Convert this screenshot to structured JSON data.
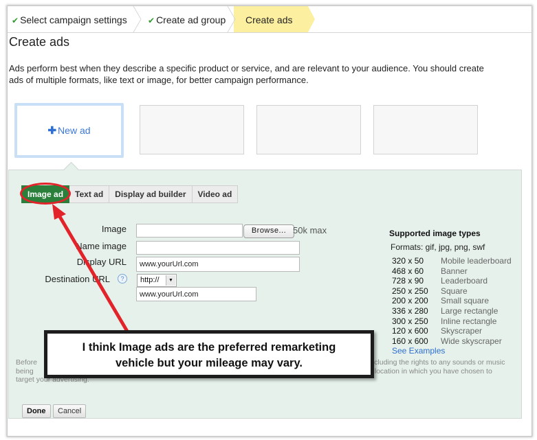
{
  "steps": [
    {
      "label": "Select campaign settings",
      "completed": true
    },
    {
      "label": "Create ad group",
      "completed": true
    },
    {
      "label": "Create ads",
      "completed": false,
      "active": true
    }
  ],
  "page_title": "Create ads",
  "intro": "Ads perform best when they describe a specific product or service, and are relevant to your audience. You should create ads of multiple formats, like text or image, for better campaign performance.",
  "new_ad": {
    "icon": "plus-icon",
    "label": "New ad"
  },
  "ad_type_tabs": [
    {
      "label": "Image ad",
      "active": true
    },
    {
      "label": "Text ad",
      "active": false
    },
    {
      "label": "Display ad builder",
      "active": false
    },
    {
      "label": "Video ad",
      "active": false
    }
  ],
  "form": {
    "image_label": "Image",
    "image_value": "",
    "browse_label": "Browse...",
    "max_note": "50k max",
    "name_image_label": "Name image",
    "name_image_value": "",
    "display_url_label": "Display URL",
    "display_url_value": "www.yourUrl.com",
    "destination_url_label": "Destination URL",
    "help_icon": "?",
    "protocol_selected": "http://",
    "destination_url_value": "www.yourUrl.com"
  },
  "supported": {
    "title": "Supported image types",
    "formats": "Formats: gif, jpg, png, swf",
    "sizes": [
      {
        "dim": "320 x 50",
        "name": "Mobile leaderboard"
      },
      {
        "dim": "468 x 60",
        "name": "Banner"
      },
      {
        "dim": "728 x 90",
        "name": "Leaderboard"
      },
      {
        "dim": "250 x 250",
        "name": "Square"
      },
      {
        "dim": "200 x 200",
        "name": "Small square"
      },
      {
        "dim": "336 x 280",
        "name": "Large rectangle"
      },
      {
        "dim": "300 x 250",
        "name": "Inline rectangle"
      },
      {
        "dim": "120 x 600",
        "name": "Skyscraper"
      },
      {
        "dim": "160 x 600",
        "name": "Wide skyscraper"
      }
    ],
    "see_examples": "See Examples"
  },
  "policy": {
    "left_lines": [
      "Before",
      "being",
      "target your advertising."
    ],
    "right_lines": [
      "including the rights to any sounds or music",
      "e location in which you have chosen to"
    ]
  },
  "buttons": {
    "done": "Done",
    "cancel": "Cancel"
  },
  "annotation": {
    "text_line1": "I think Image ads are the preferred remarketing",
    "text_line2": "vehicle but your mileage may vary.",
    "color": "#e2232a"
  },
  "colors": {
    "active_step": "#fcef9f",
    "active_tab": "#2a7f3b",
    "panel_bg": "#e5f1ea",
    "link": "#2f6fcf",
    "check": "#2d9b2d"
  }
}
